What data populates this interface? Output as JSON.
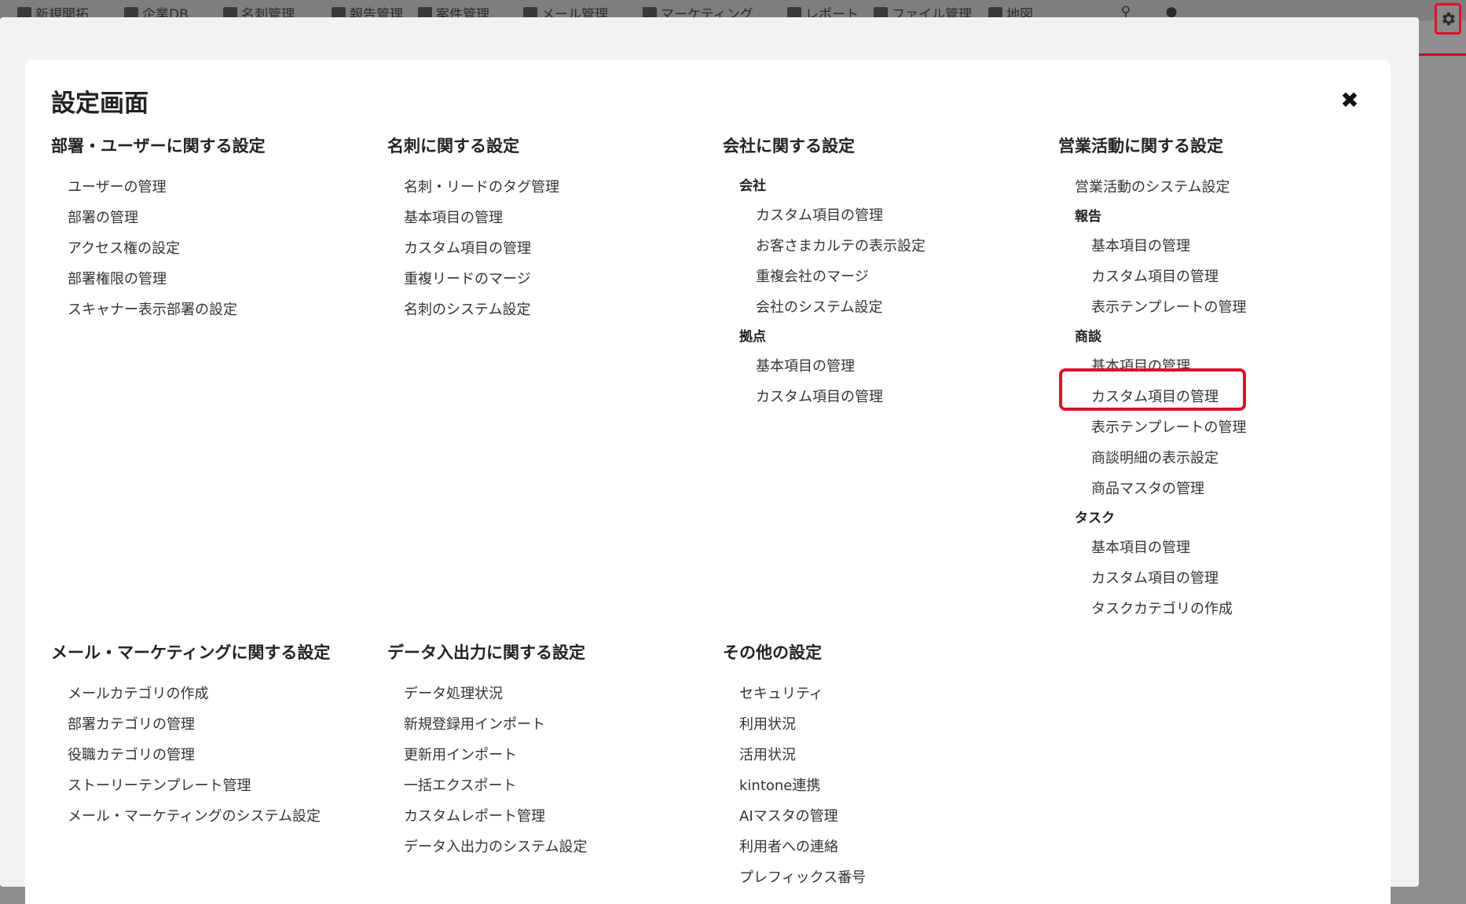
{
  "topbar": {
    "nav": [
      "新規開拓",
      "企業DB",
      "名刺管理",
      "報告管理",
      "案件管理",
      "メール管理",
      "マーケティング",
      "レポート",
      "ファイル管理",
      "地図"
    ]
  },
  "modal": {
    "title": "設定画面",
    "close_label": "✖"
  },
  "sections": {
    "users": {
      "title": "部署・ユーザーに関する設定",
      "items": [
        "ユーザーの管理",
        "部署の管理",
        "アクセス権の設定",
        "部署権限の管理",
        "スキャナー表示部署の設定"
      ]
    },
    "cards": {
      "title": "名刺に関する設定",
      "items": [
        "名刺・リードのタグ管理",
        "基本項目の管理",
        "カスタム項目の管理",
        "重複リードのマージ",
        "名刺のシステム設定"
      ]
    },
    "company": {
      "title": "会社に関する設定",
      "group1": "会社",
      "group1_items": [
        "カスタム項目の管理",
        "お客さまカルテの表示設定",
        "重複会社のマージ",
        "会社のシステム設定"
      ],
      "group2": "拠点",
      "group2_items": [
        "基本項目の管理",
        "カスタム項目の管理"
      ]
    },
    "sales": {
      "title": "営業活動に関する設定",
      "top_item": "営業活動のシステム設定",
      "report": "報告",
      "report_items": [
        "基本項目の管理",
        "カスタム項目の管理",
        "表示テンプレートの管理"
      ],
      "deal": "商談",
      "deal_items": [
        "基本項目の管理",
        "カスタム項目の管理",
        "表示テンプレートの管理",
        "商談明細の表示設定",
        "商品マスタの管理"
      ],
      "task": "タスク",
      "task_items": [
        "基本項目の管理",
        "カスタム項目の管理",
        "タスクカテゴリの作成"
      ]
    },
    "mail": {
      "title": "メール・マーケティングに関する設定",
      "items": [
        "メールカテゴリの作成",
        "部署カテゴリの管理",
        "役職カテゴリの管理",
        "ストーリーテンプレート管理",
        "メール・マーケティングのシステム設定"
      ]
    },
    "data": {
      "title": "データ入出力に関する設定",
      "items": [
        "データ処理状況",
        "新規登録用インポート",
        "更新用インポート",
        "一括エクスポート",
        "カスタムレポート管理",
        "データ入出力のシステム設定"
      ]
    },
    "other": {
      "title": "その他の設定",
      "items": [
        "セキュリティ",
        "利用状況",
        "活用状況",
        "kintone連携",
        "AIマスタの管理",
        "利用者への連絡",
        "プレフィックス番号"
      ]
    }
  },
  "colors": {
    "highlight": "#e0102a",
    "overlay": "#8f8f8f"
  },
  "icons": [
    "search-icon",
    "bell-icon",
    "gear-icon",
    "close-icon"
  ]
}
